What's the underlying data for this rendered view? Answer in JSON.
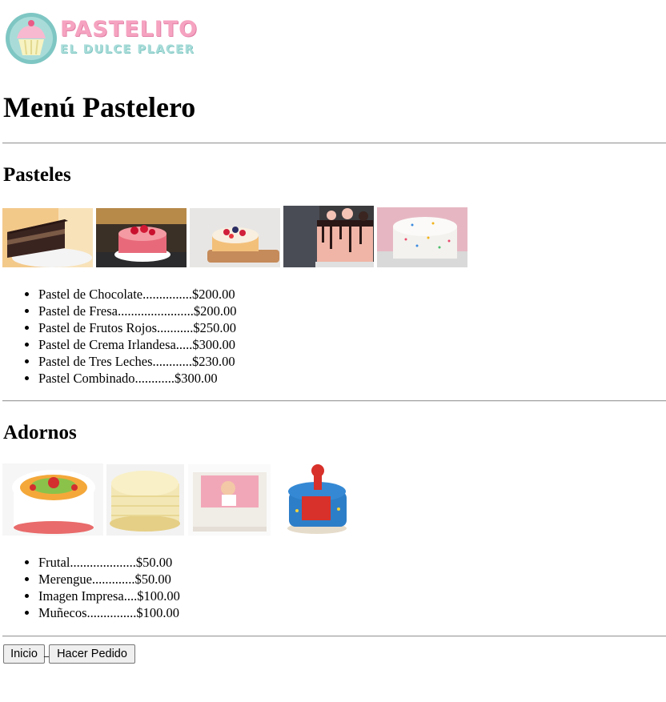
{
  "brand": {
    "name": "PASTELITO",
    "tagline": "EL DULCE PLACER",
    "colors": {
      "pink": "#f5a3c0",
      "teal": "#7ec6c3",
      "cream": "#f7f3c2"
    }
  },
  "page_title": "Menú Pastelero",
  "sections": {
    "pasteles": {
      "heading": "Pasteles",
      "images": [
        "chocolate-cake-photo",
        "strawberry-cake-photo",
        "berries-cake-photo",
        "drip-cake-photo",
        "sprinkles-cake-photo"
      ],
      "items": [
        "Pastel de Chocolate...............$200.00",
        "Pastel de Fresa.......................$200.00",
        "Pastel de Frutos Rojos...........$250.00",
        "Pastel de Crema Irlandesa.....$300.00",
        "Pastel de Tres Leches............$230.00",
        "Pastel Combinado............$300.00"
      ]
    },
    "adornos": {
      "heading": "Adornos",
      "images": [
        "fruit-decorated-cake-photo",
        "meringue-cake-photo",
        "printed-image-cake-photo",
        "spiderman-figure-cake-photo"
      ],
      "items": [
        "Frutal....................$50.00",
        "Merengue.............$50.00",
        "Imagen Impresa....$100.00",
        "Muñecos...............$100.00"
      ]
    }
  },
  "buttons": {
    "home": "Inicio",
    "separator": "_",
    "order": "Hacer Pedido"
  }
}
